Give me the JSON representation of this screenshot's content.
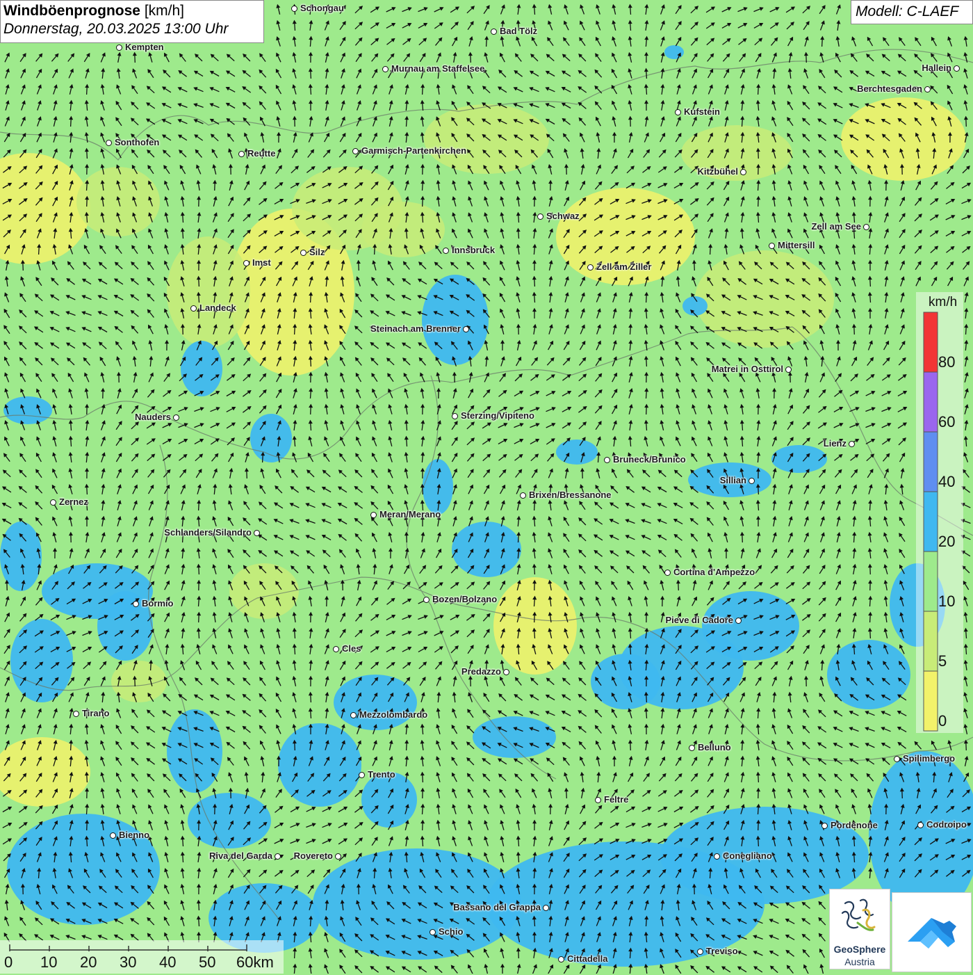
{
  "header": {
    "title_bold": "Windböenprognose",
    "title_unit": "[km/h]",
    "datetime": "Donnerstag, 20.03.2025 13:00 Uhr"
  },
  "model": {
    "label": "Modell: C-LAEF"
  },
  "colors": {
    "cat_0_5": "#f2f26a",
    "cat_5_10": "#c8ec78",
    "cat_10_20": "#9eea8c",
    "cat_20_40": "#3fb8f0",
    "cat_40_60": "#5f8ef0",
    "cat_60_80": "#9a66ee",
    "cat_80_plus": "#f23535",
    "border_line": "#6a7a6a",
    "arrow": "#111111"
  },
  "legend": {
    "unit": "km/h",
    "labels": [
      "80",
      "60",
      "40",
      "20",
      "10",
      "5",
      "0"
    ]
  },
  "scalebar": {
    "labels": [
      "0",
      "10",
      "20",
      "30",
      "40",
      "50",
      "60km"
    ]
  },
  "logos": {
    "geosphere_line1": "GeoSphere",
    "geosphere_line2": "Austria",
    "app_icon": "geosphere-warn-app-icon"
  },
  "cities": [
    {
      "name": "Schongau"
    },
    {
      "name": "Bad Tölz"
    },
    {
      "name": "Kempten"
    },
    {
      "name": "Murnau am Staffelsee"
    },
    {
      "name": "Hallein"
    },
    {
      "name": "Berchtesgaden"
    },
    {
      "name": "Kufstein"
    },
    {
      "name": "Sonthofen"
    },
    {
      "name": "Reutte"
    },
    {
      "name": "Garmisch-Partenkirchen"
    },
    {
      "name": "Kitzbühel"
    },
    {
      "name": "Schwaz"
    },
    {
      "name": "Zell am See"
    },
    {
      "name": "Mittersill"
    },
    {
      "name": "Silz"
    },
    {
      "name": "Innsbruck"
    },
    {
      "name": "Imst"
    },
    {
      "name": "Zell am Ziller"
    },
    {
      "name": "Landeck"
    },
    {
      "name": "Steinach am Brenner"
    },
    {
      "name": "Matrei in Osttirol"
    },
    {
      "name": "Nauders"
    },
    {
      "name": "Sterzing/Vipiteno"
    },
    {
      "name": "Lienz"
    },
    {
      "name": "Bruneck/Brunico"
    },
    {
      "name": "Sillian"
    },
    {
      "name": "Brixen/Bressanone"
    },
    {
      "name": "Zernez"
    },
    {
      "name": "Meran/Merano"
    },
    {
      "name": "Schlanders/Silandro"
    },
    {
      "name": "Cortina d'Ampezzo"
    },
    {
      "name": "Bozen/Bolzano"
    },
    {
      "name": "Bormio"
    },
    {
      "name": "Pieve di Cadore"
    },
    {
      "name": "Cles"
    },
    {
      "name": "Predazzo"
    },
    {
      "name": "Tirano"
    },
    {
      "name": "Mezzolombardo"
    },
    {
      "name": "Belluno"
    },
    {
      "name": "Spilimbergo"
    },
    {
      "name": "Trento"
    },
    {
      "name": "Feltre"
    },
    {
      "name": "Pordenone"
    },
    {
      "name": "Codroipo"
    },
    {
      "name": "Bienno"
    },
    {
      "name": "Riva del Garda"
    },
    {
      "name": "Rovereto"
    },
    {
      "name": "Conegliano"
    },
    {
      "name": "Bassano del Grappa"
    },
    {
      "name": "Schio"
    },
    {
      "name": "Treviso"
    },
    {
      "name": "Cittadella"
    }
  ]
}
